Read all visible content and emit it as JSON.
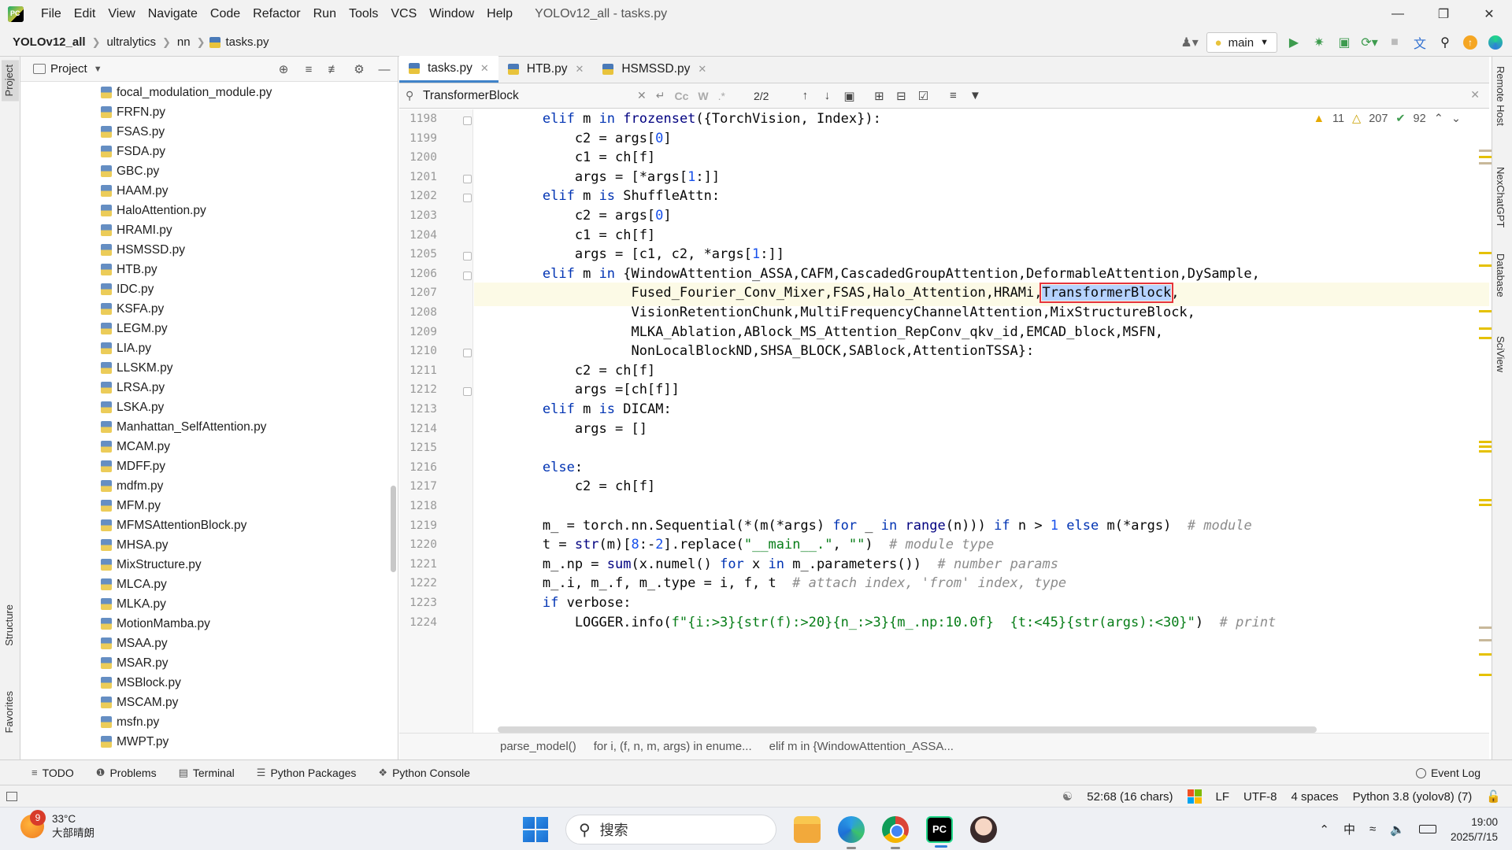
{
  "menu": {
    "items": [
      "File",
      "Edit",
      "View",
      "Navigate",
      "Code",
      "Refactor",
      "Run",
      "Tools",
      "VCS",
      "Window",
      "Help"
    ],
    "window_title": "YOLOv12_all - tasks.py"
  },
  "navbar": {
    "breadcrumbs": [
      "YOLOv12_all",
      "ultralytics",
      "nn",
      "tasks.py"
    ],
    "branch": "main"
  },
  "left_strip": {
    "project": "Project",
    "structure": "Structure",
    "favorites": "Favorites"
  },
  "project_panel": {
    "title": "Project",
    "files": [
      "focal_modulation_module.py",
      "FRFN.py",
      "FSAS.py",
      "FSDA.py",
      "GBC.py",
      "HAAM.py",
      "HaloAttention.py",
      "HRAMI.py",
      "HSMSSD.py",
      "HTB.py",
      "IDC.py",
      "KSFA.py",
      "LEGM.py",
      "LIA.py",
      "LLSKM.py",
      "LRSA.py",
      "LSKA.py",
      "Manhattan_SelfAttention.py",
      "MCAM.py",
      "MDFF.py",
      "mdfm.py",
      "MFM.py",
      "MFMSAttentionBlock.py",
      "MHSA.py",
      "MixStructure.py",
      "MLCA.py",
      "MLKA.py",
      "MotionMamba.py",
      "MSAA.py",
      "MSAR.py",
      "MSBlock.py",
      "MSCAM.py",
      "msfn.py",
      "MWPT.py"
    ]
  },
  "editor": {
    "tabs": [
      {
        "label": "tasks.py",
        "active": true
      },
      {
        "label": "HTB.py",
        "active": false
      },
      {
        "label": "HSMSSD.py",
        "active": false
      }
    ],
    "search": {
      "value": "TransformerBlock",
      "match_count": "2/2",
      "opt_case": "Cc",
      "opt_word": "W",
      "opt_regex": ".*"
    },
    "inspections": {
      "warnings": "11",
      "weak_warnings": "207",
      "typos": "92"
    },
    "line_numbers": [
      "1198",
      "1199",
      "1200",
      "1201",
      "1202",
      "1203",
      "1204",
      "1205",
      "1206",
      "1207",
      "1208",
      "1209",
      "1210",
      "1211",
      "1212",
      "1213",
      "1214",
      "1215",
      "1216",
      "1217",
      "1218",
      "1219",
      "1220",
      "1221",
      "1222",
      "1223",
      "1224"
    ],
    "current_line": "1207",
    "breadcrumbs": [
      "parse_model()",
      "for i, (f, n, m, args) in enume...",
      "elif m in {WindowAttention_ASSA..."
    ]
  },
  "right_strip": {
    "remote_host": "Remote Host",
    "nexchatgpt": "NexChatGPT",
    "database": "Database",
    "sciview": "SciView"
  },
  "bottom_tools": [
    "TODO",
    "Problems",
    "Terminal",
    "Python Packages",
    "Python Console"
  ],
  "event_log": "Event Log",
  "status": {
    "position": "52:68 (16 chars)",
    "line_sep": "LF",
    "encoding": "UTF-8",
    "indent": "4 spaces",
    "interpreter": "Python 3.8 (yolov8) (7)"
  },
  "taskbar": {
    "weather_temp": "33°C",
    "weather_desc": "大部晴朗",
    "weather_badge": "9",
    "search_placeholder": "搜索",
    "ime": "中",
    "time": "19:00",
    "date": "2025/7/15"
  },
  "colors": {
    "keyword": "#0033b3",
    "builtin": "#000080",
    "number": "#1750eb",
    "string": "#067d17",
    "comment": "#8c8c8c",
    "search_highlight": "#b5d2ff",
    "highlight_outline": "#e6343c",
    "tab_accent": "#4083c9"
  },
  "icons": {
    "search": "magnifier-icon",
    "run": "play-icon",
    "debug": "bug-icon",
    "stop": "stop-icon"
  }
}
